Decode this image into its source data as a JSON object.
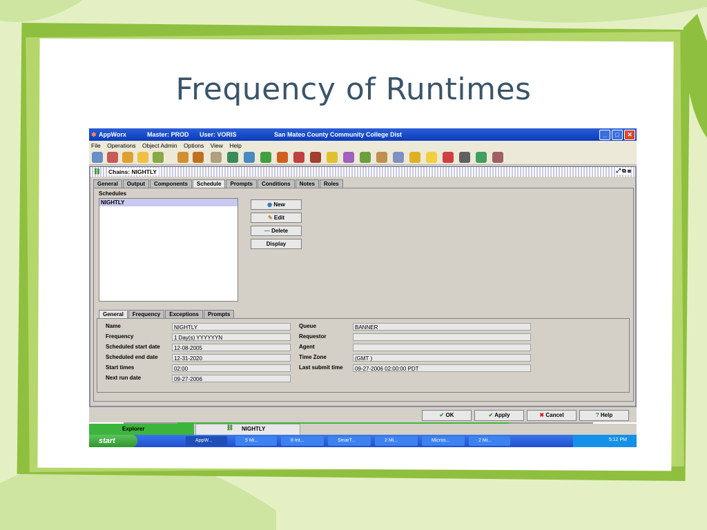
{
  "slide": {
    "title": "Frequency of Runtimes"
  },
  "window": {
    "app_name": "AppWorx",
    "master": "Master: PROD",
    "user": "User: VORIS",
    "org": "San Mateo County Community College Dist"
  },
  "menu": [
    "File",
    "Operations",
    "Object Admin",
    "Options",
    "View",
    "Help"
  ],
  "toolbar_icons": [
    "explorer-icon",
    "check-icon",
    "printer-icon",
    "ring-icon",
    "chain-icon",
    "bar-icon",
    "books-icon",
    "wand-icon",
    "globe-icon",
    "screen-icon",
    "cubes-icon",
    "stack-icon",
    "stack2-icon",
    "log-icon",
    "folder-icon",
    "paint-icon",
    "cubes2-icon",
    "tools-icon",
    "label-icon",
    "lock-icon",
    "face-icon",
    "star-icon",
    "hash-icon",
    "ball-icon",
    "people-icon"
  ],
  "inner": {
    "title": "Chains: NIGHTLY",
    "tabs": [
      "General",
      "Output",
      "Components",
      "Schedule",
      "Prompts",
      "Conditions",
      "Notes",
      "Roles"
    ],
    "active_tab": "Schedule",
    "schedules_label": "Schedules",
    "schedule_items": [
      "NIGHTLY"
    ],
    "buttons": {
      "new": "New",
      "edit": "Edit",
      "delete": "Delete",
      "display": "Display"
    },
    "subtabs": [
      "General",
      "Frequency",
      "Exceptions",
      "Prompts"
    ],
    "active_subtab": "General",
    "fields_left": [
      {
        "label": "Name",
        "value": "NIGHTLY"
      },
      {
        "label": "Frequency",
        "value": "1 Day(s) YYYYYYN"
      },
      {
        "label": "Scheduled start date",
        "value": "12-08-2005"
      },
      {
        "label": "Scheduled end date",
        "value": "12-31-2020"
      },
      {
        "label": "Start times",
        "value": "02:00"
      },
      {
        "label": "Next run date",
        "value": "09-27-2006"
      }
    ],
    "fields_right": [
      {
        "label": "Queue",
        "value": "BANNER"
      },
      {
        "label": "Requestor",
        "value": ""
      },
      {
        "label": "Agent",
        "value": ""
      },
      {
        "label": "Time Zone",
        "value": "(GMT )"
      },
      {
        "label": "Last submit time",
        "value": "09-27-2006 02:00:00 PDT"
      }
    ],
    "footer_buttons": {
      "ok": "OK",
      "apply": "Apply",
      "cancel": "Cancel",
      "help": "Help"
    }
  },
  "taskrow": {
    "explorer": "Explorer",
    "nightly": "NIGHTLY"
  },
  "taskbar": {
    "start": "start",
    "tasks": [
      "AppW...",
      "5 Mi...",
      "8 Int...",
      "SmarT...",
      "2 Mi...",
      "Micros...",
      "2 Mi..."
    ],
    "clock": "5:12 PM"
  },
  "colors": {
    "title": "#3b5468",
    "xp_blue": "#1f4fd0",
    "start_green": "#3a9a3a",
    "frame_green": "#8fbf3f"
  }
}
